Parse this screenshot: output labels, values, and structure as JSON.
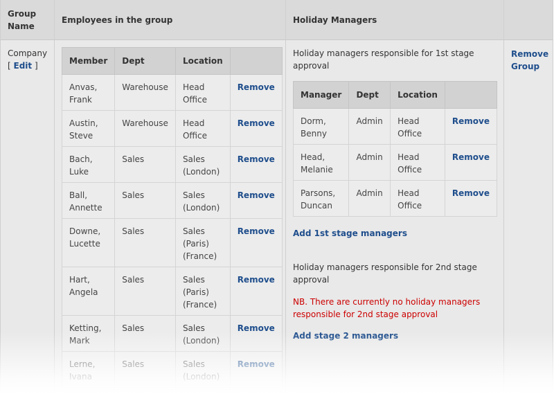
{
  "header": {
    "group_name": "Group Name",
    "employees": "Employees in the group",
    "holiday_managers": "Holiday Managers"
  },
  "group": {
    "name": "Company",
    "edit_open": "[",
    "edit_label": "Edit",
    "edit_close": "]",
    "remove_group_label": "Remove Group"
  },
  "members": {
    "columns": [
      "Member",
      "Dept",
      "Location",
      ""
    ],
    "remove_label": "Remove",
    "rows": [
      {
        "name": "Anvas, Frank",
        "dept": "Warehouse",
        "location": "Head Office"
      },
      {
        "name": "Austin, Steve",
        "dept": "Warehouse",
        "location": "Head Office"
      },
      {
        "name": "Bach, Luke",
        "dept": "Sales",
        "location": "Sales (London)"
      },
      {
        "name": "Ball, Annette",
        "dept": "Sales",
        "location": "Sales (London)"
      },
      {
        "name": "Downe, Lucette",
        "dept": "Sales",
        "location": "Sales (Paris) (France)"
      },
      {
        "name": "Hart, Angela",
        "dept": "Sales",
        "location": "Sales (Paris) (France)"
      },
      {
        "name": "Ketting, Mark",
        "dept": "Sales",
        "location": "Sales (London)"
      },
      {
        "name": "Lerne, Ivana",
        "dept": "Sales",
        "location": "Sales (London)"
      }
    ]
  },
  "stage1": {
    "intro": "Holiday managers responsible for 1st stage approval",
    "columns": [
      "Manager",
      "Dept",
      "Location",
      ""
    ],
    "remove_label": "Remove",
    "rows": [
      {
        "name": "Dorm, Benny",
        "dept": "Admin",
        "location": "Head Office"
      },
      {
        "name": "Head, Melanie",
        "dept": "Admin",
        "location": "Head Office"
      },
      {
        "name": "Parsons, Duncan",
        "dept": "Admin",
        "location": "Head Office"
      }
    ],
    "add_label": "Add 1st stage managers"
  },
  "stage2": {
    "intro": "Holiday managers responsible for 2nd stage approval",
    "warning": "NB. There are currently no holiday managers responsible for 2nd stage approval",
    "add_label": "Add stage 2 managers"
  },
  "colors": {
    "link": "#1f4e8c",
    "warning": "#cc0000",
    "header_bg": "#dadada",
    "table_header_bg": "#d2d2d2"
  }
}
